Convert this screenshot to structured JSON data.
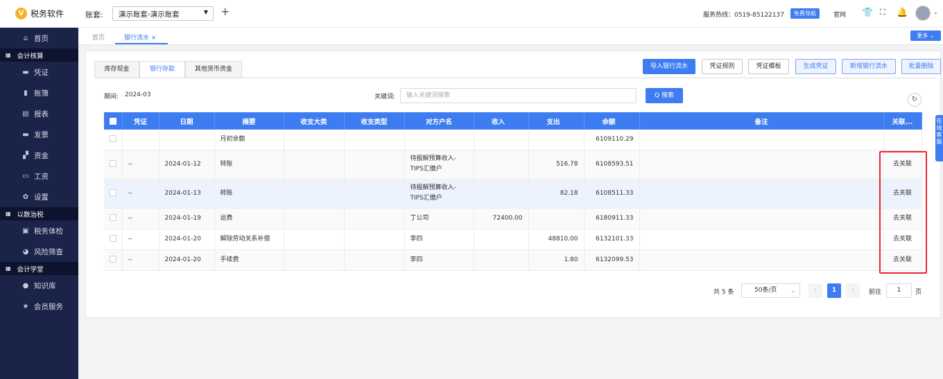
{
  "app": {
    "logo_glyph": "V",
    "name": "税务软件"
  },
  "header": {
    "account_label": "账套:",
    "account_value": "演示账套-演示账套",
    "hotline": "服务热线：0519-85122137",
    "free_nav": "免费导航",
    "official_site": "官网"
  },
  "sidebar": {
    "items_top": [
      {
        "icon": "home-icon",
        "glyph": "⌂",
        "label": "首页"
      }
    ],
    "group1": "会计核算",
    "items1": [
      {
        "icon": "voucher-icon",
        "glyph": "▬",
        "label": "凭证"
      },
      {
        "icon": "ledger-icon",
        "glyph": "▮",
        "label": "账簿"
      },
      {
        "icon": "report-icon",
        "glyph": "▤",
        "label": "报表"
      },
      {
        "icon": "invoice-icon",
        "glyph": "▬",
        "label": "发票"
      },
      {
        "icon": "funds-icon",
        "glyph": "▞",
        "label": "资金"
      },
      {
        "icon": "salary-icon",
        "glyph": "▭",
        "label": "工资"
      },
      {
        "icon": "settings-icon",
        "glyph": "✿",
        "label": "设置"
      }
    ],
    "group2": "以数治税",
    "items2": [
      {
        "icon": "tax-check-icon",
        "glyph": "▣",
        "label": "税务体检"
      },
      {
        "icon": "risk-scan-icon",
        "glyph": "◕",
        "label": "风险筛查"
      }
    ],
    "group3": "会计学堂",
    "items3": [
      {
        "icon": "knowledge-icon",
        "glyph": "●",
        "label": "知识库"
      },
      {
        "icon": "member-icon",
        "glyph": "★",
        "label": "会员服务"
      }
    ]
  },
  "page_tabs": {
    "home": "首页",
    "active": "银行流水 ×",
    "more": "更多 ⌄"
  },
  "content_tabs": [
    "库存现金",
    "银行存款",
    "其他货币资金"
  ],
  "actions": {
    "import": "导入银行流水",
    "rules": "凭证规则",
    "template": "凭证模板",
    "generate": "生成凭证",
    "add": "新增银行流水",
    "batch_delete": "批量删除"
  },
  "filter": {
    "period_label": "期间:",
    "period_value": "2024-03",
    "keyword_label": "关键词:",
    "keyword_placeholder": "输入关键词搜索",
    "search": "Q 搜索"
  },
  "side_float": "在线客服",
  "table": {
    "headers": [
      "凭证",
      "日期",
      "摘要",
      "收支大类",
      "收支类型",
      "对方户名",
      "收入",
      "支出",
      "余额",
      "备注",
      "关联..."
    ],
    "rows": [
      {
        "voucher": "",
        "date": "",
        "summary": "月初余额",
        "cat": "",
        "type": "",
        "party": "",
        "income": "",
        "expense": "",
        "balance": "6109110.29",
        "note": "",
        "link": ""
      },
      {
        "voucher": "--",
        "date": "2024-01-12",
        "summary": "转账",
        "cat": "",
        "type": "",
        "party": "待报解预算收入-TIPS汇缴户",
        "income": "",
        "expense": "516.78",
        "balance": "6108593.51",
        "note": "",
        "link": "去关联"
      },
      {
        "voucher": "--",
        "date": "2024-01-13",
        "summary": "转账",
        "cat": "",
        "type": "",
        "party": "待报解预算收入-TIPS汇缴户",
        "income": "",
        "expense": "82.18",
        "balance": "6108511.33",
        "note": "",
        "link": "去关联"
      },
      {
        "voucher": "--",
        "date": "2024-01-19",
        "summary": "运费",
        "cat": "",
        "type": "",
        "party": "丁公司",
        "income": "72400.00",
        "expense": "",
        "balance": "6180911.33",
        "note": "",
        "link": "去关联"
      },
      {
        "voucher": "--",
        "date": "2024-01-20",
        "summary": "解除劳动关系补偿",
        "cat": "",
        "type": "",
        "party": "李四",
        "income": "",
        "expense": "48810.00",
        "balance": "6132101.33",
        "note": "",
        "link": "去关联"
      },
      {
        "voucher": "--",
        "date": "2024-01-20",
        "summary": "手续费",
        "cat": "",
        "type": "",
        "party": "李四",
        "income": "",
        "expense": "1.80",
        "balance": "6132099.53",
        "note": "",
        "link": "去关联"
      }
    ]
  },
  "pagination": {
    "total": "共 5 条",
    "page_size": "50条/页",
    "prev": "‹",
    "current": "1",
    "next": "›",
    "goto_label": "前往",
    "goto_value": "1",
    "page_suffix": "页"
  },
  "colors": {
    "primary": "#3d7cf1",
    "sidebar": "#1a2348",
    "highlight_box": "#e8252e"
  }
}
